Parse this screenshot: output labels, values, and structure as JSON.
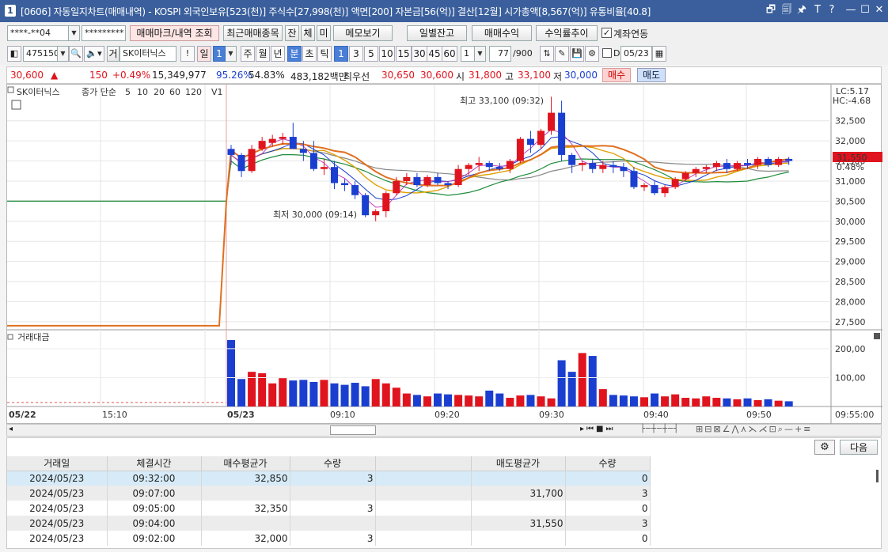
{
  "window": {
    "icon": "1",
    "title": "[0606] 자동일지차트(매매내역) - KOSPI 외국인보유[523(천)] 주식수[27,998(천)] 액면[200] 자본금[56(억)] 결산[12월] 시가총액[8,567(억)] 유통비율[40.8]",
    "buttons": [
      "🗗",
      "🗐",
      "🖈",
      "T",
      "?",
      "—",
      "☐",
      "✕"
    ]
  },
  "toolbar1": {
    "account": "****-**04",
    "password": "*********",
    "mark_btn": "매매마크/내역 조회",
    "recent_btn": "최근매매종목",
    "btn_jan": "잔",
    "btn_che": "체",
    "btn_mi": "미",
    "memo_btn": "메모보기",
    "daily_btn": "일별잔고",
    "profit_btn": "매매수익",
    "rate_btn": "수익률추이",
    "link_label": "계좌연동"
  },
  "toolbar2": {
    "code": "475150",
    "geo": "거",
    "stock": "SK이터닉스",
    "excl": "!",
    "period_il": "일",
    "period_num": "1",
    "periods": [
      "주",
      "월",
      "년",
      "분",
      "초",
      "틱"
    ],
    "minutes": [
      "1",
      "3",
      "5",
      "10",
      "15",
      "30",
      "45",
      "60"
    ],
    "minute_select": "1",
    "count": "77",
    "count_total": "/900",
    "d_label": "D",
    "date": "05/23"
  },
  "quote": {
    "price": "30,600",
    "arrow": "▲",
    "change": "150",
    "change_pct": "+0.49%",
    "volume": "15,349,977",
    "ratio1": "95.26%",
    "ratio2": "54.83%",
    "amount": "483,182백만",
    "best_label": "최우선",
    "bid": "30,650",
    "ask": "30,600",
    "open_label": "시",
    "open": "31,800",
    "high_label": "고",
    "high": "33,100",
    "low_label": "저",
    "low": "30,000",
    "buy_btn": "매수",
    "sell_btn": "매도"
  },
  "chart_legend": {
    "name": "SK이터닉스",
    "close_label": "종가 단순",
    "ma5": "5",
    "ma10": "10",
    "ma20": "20",
    "ma60": "60",
    "ma120": "120",
    "v": "V1"
  },
  "chart_info": {
    "lc": "LC:5.17",
    "hc": "HC:-4.68",
    "current": "31,550",
    "current_pct": "0.48%",
    "high_note": "최고 33,100 (09:32)",
    "low_note": "최저 30,000 (09:14)",
    "vol_title": "거래대금"
  },
  "chart_data": {
    "type": "candlestick",
    "title": "",
    "y_ticks": [
      "32,500",
      "32,000",
      "31,500",
      "31,000",
      "30,500",
      "30,000",
      "29,500",
      "29,000",
      "28,500",
      "28,000",
      "27,500"
    ],
    "ylim": [
      27300,
      33400
    ],
    "x_ticks": [
      "05/22",
      "15:10",
      "05/23",
      "09:10",
      "09:20",
      "09:30",
      "09:40",
      "09:50",
      "09:55:00"
    ],
    "candles": [
      [
        31800,
        31900,
        31400,
        31650
      ],
      [
        31650,
        31700,
        31100,
        31250
      ],
      [
        31250,
        31900,
        31200,
        31800
      ],
      [
        31800,
        32100,
        31750,
        32000
      ],
      [
        31950,
        32150,
        31850,
        32050
      ],
      [
        32050,
        32200,
        31900,
        32100
      ],
      [
        32100,
        32450,
        31800,
        31800
      ],
      [
        31800,
        32000,
        31500,
        31700
      ],
      [
        31700,
        32000,
        31250,
        31300
      ],
      [
        31300,
        31550,
        31150,
        31350
      ],
      [
        31350,
        31500,
        30800,
        30950
      ],
      [
        30950,
        31050,
        30750,
        30900
      ],
      [
        30900,
        31000,
        30550,
        30650
      ],
      [
        30650,
        30700,
        30100,
        30150
      ],
      [
        30150,
        30300,
        30000,
        30250
      ],
      [
        30250,
        30750,
        30100,
        30700
      ],
      [
        30700,
        31100,
        30650,
        31000
      ],
      [
        31000,
        31200,
        30900,
        31100
      ],
      [
        31100,
        31200,
        30850,
        30900
      ],
      [
        30900,
        31150,
        30850,
        31100
      ],
      [
        31100,
        31200,
        30900,
        30950
      ],
      [
        30950,
        31000,
        30800,
        30900
      ],
      [
        30900,
        31400,
        30850,
        31300
      ],
      [
        31300,
        31450,
        31150,
        31400
      ],
      [
        31400,
        31600,
        31250,
        31450
      ],
      [
        31450,
        31500,
        31250,
        31350
      ],
      [
        31350,
        31450,
        31250,
        31300
      ],
      [
        31300,
        31550,
        31200,
        31500
      ],
      [
        31500,
        32100,
        31450,
        32050
      ],
      [
        32050,
        32250,
        31700,
        31900
      ],
      [
        31900,
        32300,
        31800,
        32250
      ],
      [
        32250,
        33100,
        32150,
        32700
      ],
      [
        32700,
        33000,
        31500,
        31650
      ],
      [
        31650,
        31700,
        31200,
        31400
      ],
      [
        31400,
        31500,
        31250,
        31450
      ],
      [
        31450,
        31550,
        31200,
        31300
      ],
      [
        31300,
        31500,
        31200,
        31400
      ],
      [
        31400,
        31500,
        31200,
        31350
      ],
      [
        31350,
        31450,
        31100,
        31250
      ],
      [
        31250,
        31350,
        30800,
        30850
      ],
      [
        30850,
        30950,
        30750,
        30900
      ],
      [
        30900,
        31000,
        30650,
        30700
      ],
      [
        30700,
        30900,
        30600,
        30850
      ],
      [
        30850,
        31100,
        30800,
        31050
      ],
      [
        31050,
        31250,
        31000,
        31200
      ],
      [
        31200,
        31350,
        31100,
        31300
      ],
      [
        31300,
        31400,
        31200,
        31350
      ],
      [
        31350,
        31500,
        31250,
        31450
      ],
      [
        31450,
        31550,
        31200,
        31300
      ],
      [
        31300,
        31500,
        31250,
        31450
      ],
      [
        31450,
        31550,
        31300,
        31400
      ],
      [
        31400,
        31600,
        31300,
        31550
      ],
      [
        31550,
        31600,
        31350,
        31400
      ],
      [
        31400,
        31600,
        31350,
        31550
      ],
      [
        31550,
        31600,
        31400,
        31500
      ]
    ],
    "volume_ylim": [
      0,
      260
    ],
    "volume_ticks": [
      "200,00",
      "100,00"
    ],
    "volume": [
      230,
      95,
      120,
      115,
      80,
      98,
      90,
      92,
      85,
      92,
      80,
      75,
      82,
      70,
      95,
      80,
      65,
      45,
      40,
      35,
      45,
      42,
      40,
      38,
      35,
      55,
      45,
      30,
      38,
      40,
      35,
      28,
      160,
      120,
      185,
      175,
      60,
      40,
      38,
      35,
      32,
      45,
      35,
      42,
      30,
      28,
      35,
      30,
      28,
      25,
      28,
      22,
      25,
      20,
      18
    ]
  },
  "table": {
    "gear_label": "⚙",
    "next_btn": "다음",
    "headers": [
      "거래일",
      "체결시간",
      "매수평균가",
      "수량",
      "",
      "매도평균가",
      "수량"
    ],
    "rows": [
      [
        "2024/05/23",
        "09:32:00",
        "32,850",
        "3",
        "",
        "",
        "0"
      ],
      [
        "2024/05/23",
        "09:07:00",
        "",
        "",
        "",
        "31,700",
        "3"
      ],
      [
        "2024/05/23",
        "09:05:00",
        "32,350",
        "3",
        "",
        "",
        "0"
      ],
      [
        "2024/05/23",
        "09:04:00",
        "",
        "",
        "",
        "31,550",
        "3"
      ],
      [
        "2024/05/23",
        "09:02:00",
        "32,000",
        "3",
        "",
        "",
        "0"
      ]
    ]
  },
  "colors": {
    "up": "#e0141e",
    "down": "#1a3fd0",
    "title": "#3a5f9c"
  }
}
